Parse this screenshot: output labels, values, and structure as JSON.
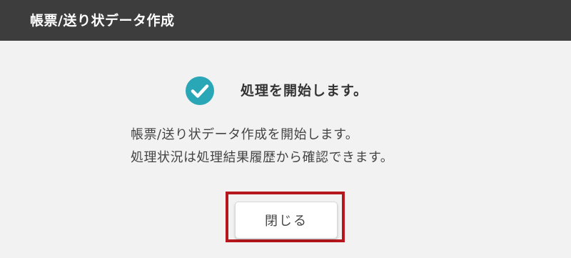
{
  "header": {
    "title": "帳票/送り状データ作成"
  },
  "status": {
    "icon": "check-circle-icon",
    "text": "処理を開始します。",
    "icon_color": "#2aa7b7"
  },
  "message": {
    "line1": "帳票/送り状データ作成を開始します。",
    "line2": "処理状況は処理結果履歴から確認できます。"
  },
  "actions": {
    "close_label": "閉じる",
    "highlight_color": "#b6171c"
  }
}
